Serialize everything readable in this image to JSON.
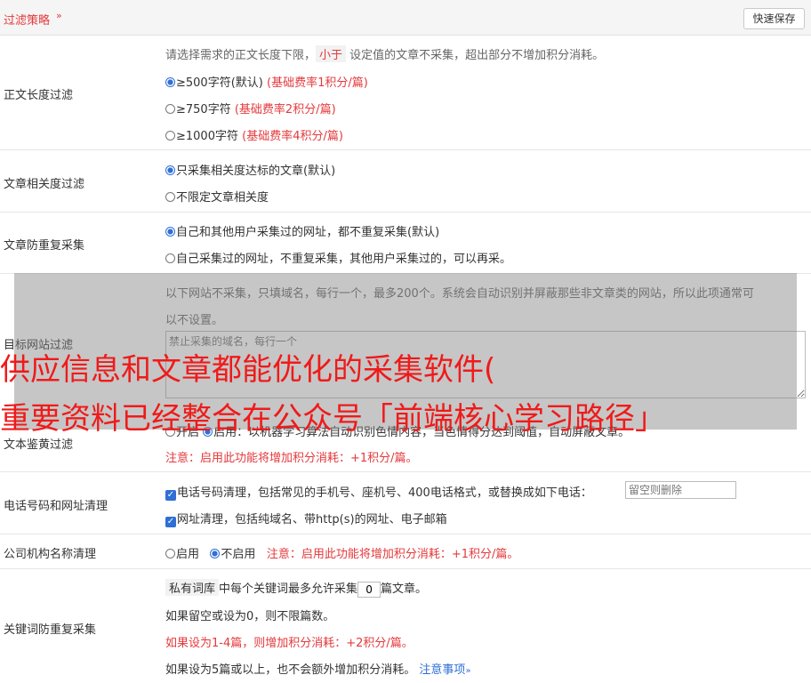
{
  "header": {
    "title": "过滤策略",
    "chevron": "»",
    "save_label": "快速保存"
  },
  "length_filter": {
    "label": "正文长度过滤",
    "hint_pre": "请选择需求的正文长度下限，",
    "hint_tag": "小于",
    "hint_post": "设定值的文章不采集，超出部分不增加积分消耗。",
    "options": [
      {
        "label": "≥500字符(默认)",
        "note": "(基础费率1积分/篇)"
      },
      {
        "label": "≥750字符",
        "note": "(基础费率2积分/篇)"
      },
      {
        "label": "≥1000字符",
        "note": "(基础费率4积分/篇)"
      }
    ]
  },
  "relevance": {
    "label": "文章相关度过滤",
    "opt1": "只采集相关度达标的文章(默认)",
    "opt2": "不限定文章相关度"
  },
  "dedup": {
    "label": "文章防重复采集",
    "opt1": "自己和其他用户采集过的网址，都不重复采集(默认)",
    "opt2": "自己采集过的网址，不重复采集，其他用户采集过的，可以再采。"
  },
  "site_filter": {
    "label": "目标网站过滤",
    "hint_line1": "以下网站不采集，只填域名，每行一个，最多200个。系统会自动识别并屏蔽那些非文章类的网站，所以此项通常可",
    "hint_line2": "以不设置。",
    "placeholder": "禁止采集的域名，每行一个"
  },
  "porn_filter": {
    "label": "文本鉴黄过滤",
    "opt_off": "开启",
    "opt_on_text": "启用：以机器学习算法自动识别色情内容，当色情得分达到阈值，自动屏蔽文章。",
    "note": "注意：启用此功能将增加积分消耗：+1积分/篇。"
  },
  "phone_clean": {
    "label": "电话号码和网址清理",
    "opt1": "电话号码清理，包括常见的手机号、座机号、400电话格式，或替换成如下电话：",
    "opt1_placeholder": "留空则删除",
    "opt2": "网址清理，包括纯域名、带http(s)的网址、电子邮箱"
  },
  "company_clean": {
    "label": "公司机构名称清理",
    "opt_on": "启用",
    "opt_off": "不启用",
    "note": "注意：启用此功能将增加积分消耗：+1积分/篇。"
  },
  "keyword_dedup": {
    "label": "关键词防重复采集",
    "tag": "私有词库",
    "line1_mid": "中每个关键词最多允许采集",
    "value": "0",
    "line1_end": "篇文章。",
    "line2": "如果留空或设为0，则不限篇数。",
    "line3": "如果设为1-4篇，则增加积分消耗：+2积分/篇。",
    "line4": "如果设为5篇或以上，也不会额外增加积分消耗。",
    "link": "注意事项",
    "link_icon": "»"
  },
  "watermark": {
    "line1": "供应信息和文章都能优化的采集软件(",
    "line2": "重要资料已经整合在公众号「前端核心学习路径」"
  },
  "colors": {
    "accent": "#e4393c",
    "check": "#2f6fd6"
  }
}
